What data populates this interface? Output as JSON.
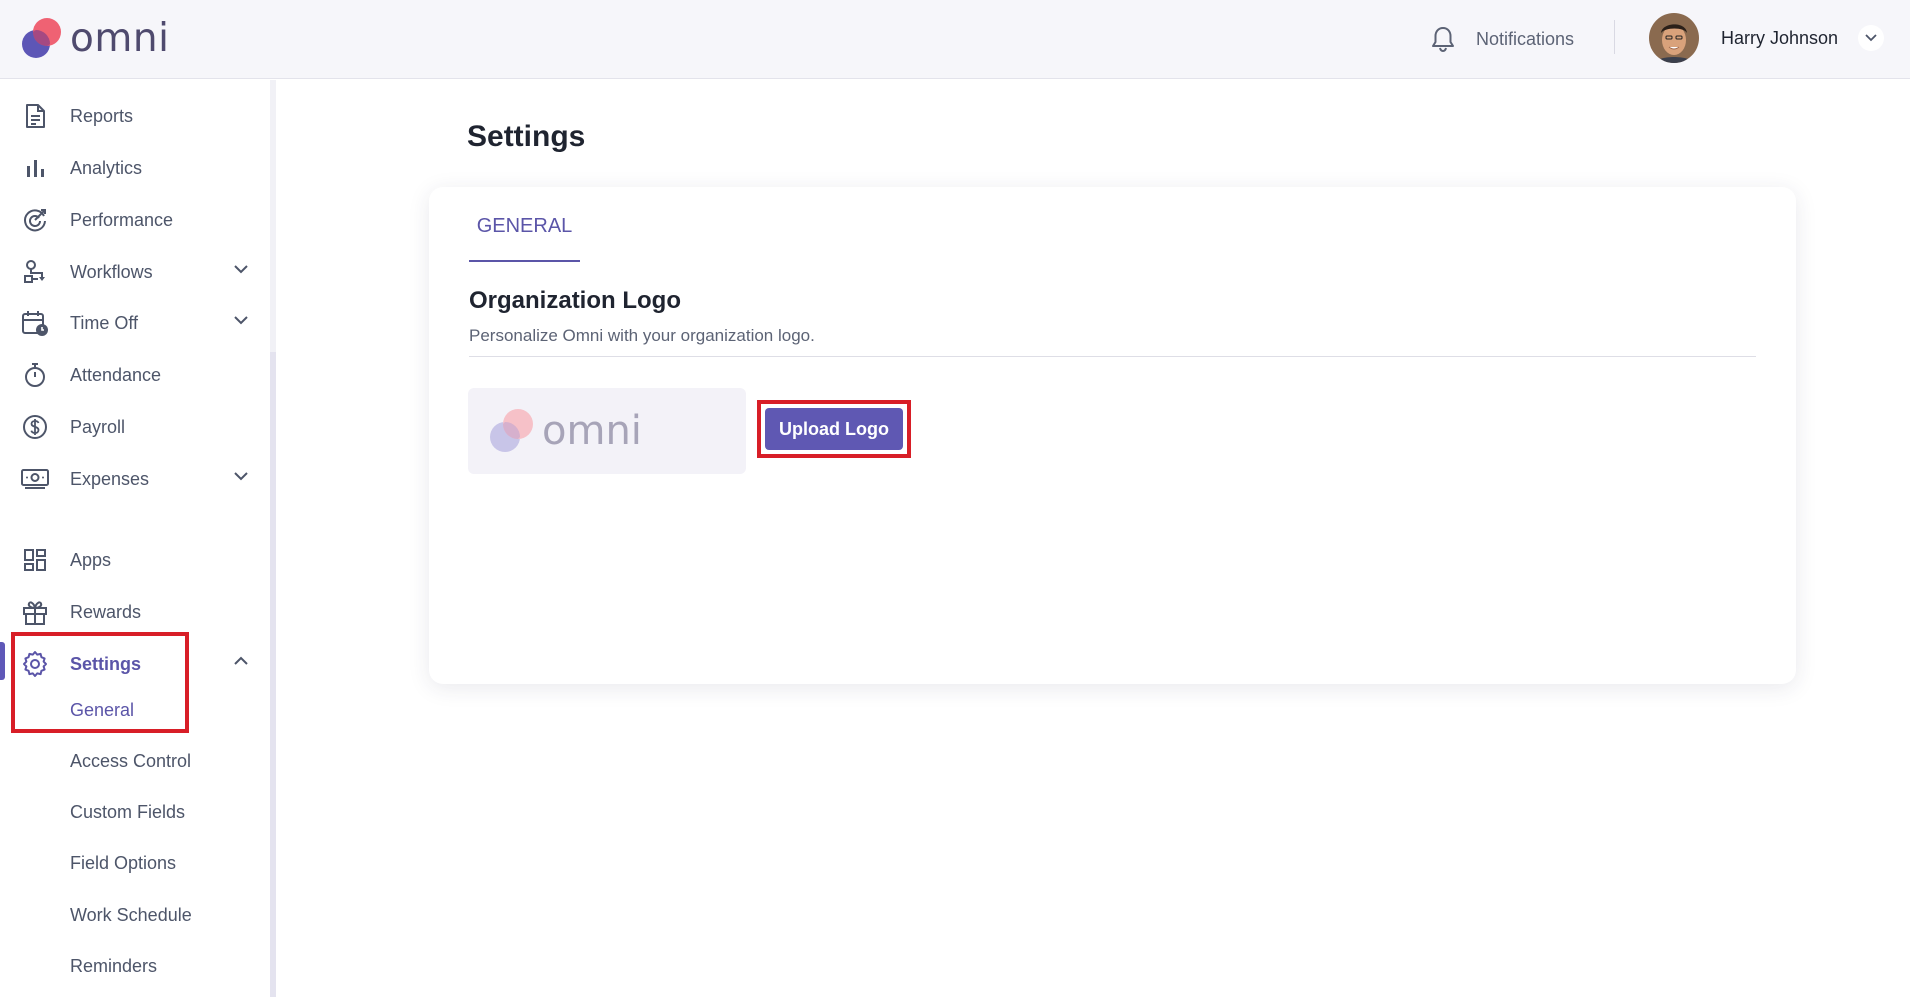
{
  "header": {
    "brand": "omni",
    "notifications_label": "Notifications",
    "user_name": "Harry Johnson"
  },
  "sidebar": {
    "items": [
      {
        "label": "Reports",
        "icon": "document-icon"
      },
      {
        "label": "Analytics",
        "icon": "bar-chart-icon"
      },
      {
        "label": "Performance",
        "icon": "performance-icon"
      },
      {
        "label": "Workflows",
        "icon": "workflow-icon"
      },
      {
        "label": "Time Off",
        "icon": "calendar-clock-icon"
      },
      {
        "label": "Attendance",
        "icon": "stopwatch-icon"
      },
      {
        "label": "Payroll",
        "icon": "dollar-icon"
      },
      {
        "label": "Expenses",
        "icon": "cash-icon"
      },
      {
        "label": "Apps",
        "icon": "grid-icon"
      },
      {
        "label": "Rewards",
        "icon": "gift-icon"
      },
      {
        "label": "Settings",
        "icon": "gear-icon"
      }
    ],
    "settings_sub": [
      "General",
      "Access Control",
      "Custom Fields",
      "Field Options",
      "Work Schedule",
      "Reminders"
    ]
  },
  "main": {
    "page_title": "Settings",
    "tab": "GENERAL",
    "section_title": "Organization Logo",
    "section_subtitle": "Personalize Omni with your organization logo.",
    "preview_word": "omni",
    "upload_button": "Upload Logo"
  },
  "colors": {
    "accent": "#5b55a8",
    "brand_red": "#ee5a6b",
    "brand_purple": "#5d56b6",
    "highlight": "#d81e27"
  }
}
